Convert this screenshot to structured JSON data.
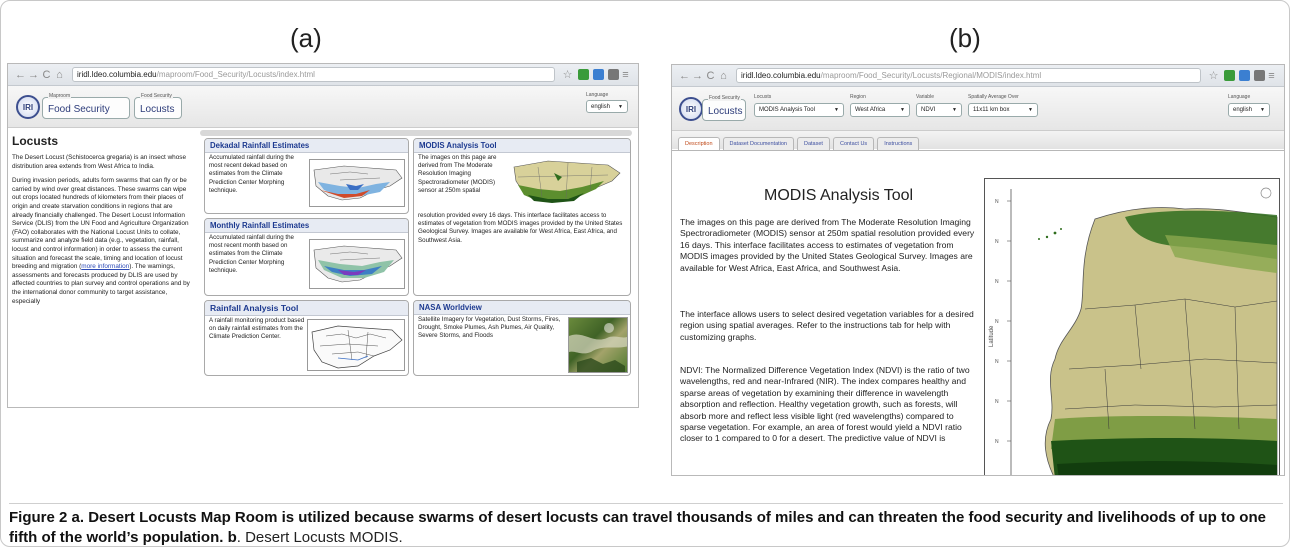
{
  "panel_a": {
    "letter": "(a)",
    "browser": {
      "back": "←",
      "forward": "→",
      "reload": "C",
      "home": "⌂",
      "url_host": "iridl.ldeo.columbia.edu",
      "url_path": "/maproom/Food_Security/Locusts/index.html",
      "menu": "≡"
    },
    "header": {
      "logo": "IRI",
      "crumb1_caption": "Maproom",
      "crumb1_value": "Food Security",
      "crumb2_caption": "Food Security",
      "crumb2_value": "Locusts",
      "language_caption": "Language",
      "language_value": "english"
    },
    "intro": {
      "title": "Locusts",
      "para1": "The Desert Locust (Schistocerca gregaria) is an insect whose distribution area extends from West Africa to India.",
      "para2_start": "During invasion periods, adults form swarms that can fly or be carried by wind over great distances. These swarms can wipe out crops located hundreds of kilometers from their places of origin and create starvation conditions in regions that are already financially challenged. The Desert Locust Information Service (DLIS) from the UN Food and Agriculture Organization (FAO) collaborates with the National Locust Units to collate, summarize and analyze field data (e.g., vegetation, rainfall, locust and control information) in order to assess the current situation and forecast the scale, timing and location of locust breeding and migration (",
      "para2_link": "more information",
      "para2_end": "). The warnings, assessments and forecasts produced by DLIS are used by affected countries to plan survey and control operations and by the international donor community to target assistance, especially"
    },
    "cards": {
      "dekadal_title": "Dekadal Rainfall Estimates",
      "dekadal_text": "Accumulated rainfall during the most recent dekad based on estimates from the Climate Prediction Center Morphing technique.",
      "monthly_title": "Monthly Rainfall Estimates",
      "monthly_text": "Accumulated rainfall during the most recent month based on estimates from the Climate Prediction Center Morphing technique.",
      "rainfall_title": "Rainfall Analysis Tool",
      "rainfall_text": "A rainfall monitoring product based on daily rainfall estimates from the Climate Prediction Center.",
      "modis_title": "MODIS Analysis Tool",
      "modis_text_top": "The images on this page are derived from The Moderate Resolution Imaging Spectroradiometer (MODIS) sensor at 250m spatial",
      "modis_text_bottom": "resolution provided every 16 days. This interface facilitates access to estimates of vegetation from MODIS images provided by the United States Geological Survey. Images are available for West Africa, East Africa, and Southwest Asia.",
      "nasa_title": "NASA Worldview",
      "nasa_text": "Satellite Imagery for Vegetation, Dust Storms, Fires, Drought, Smoke Plumes, Ash Plumes, Air Quality, Severe Storms, and Floods"
    }
  },
  "panel_b": {
    "letter": "(b)",
    "browser": {
      "url_host": "iridl.ldeo.columbia.edu",
      "url_path": "/maproom/Food_Security/Locusts/Regional/MODIS/index.html"
    },
    "header": {
      "logo": "IRI",
      "crumb_caption": "Food Security",
      "crumb_value": "Locusts",
      "locusts_caption": "Locusts",
      "locusts_value": "MODIS Analysis Tool",
      "region_caption": "Region",
      "region_value": "West Africa",
      "variable_caption": "Variable",
      "variable_value": "NDVI",
      "spatial_caption": "Spatially Average Over",
      "spatial_value": "11x11 km box",
      "language_caption": "Language",
      "language_value": "english"
    },
    "tabs": [
      "Description",
      "Dataset Documentation",
      "Dataset",
      "Contact Us",
      "Instructions"
    ],
    "title": "MODIS Analysis Tool",
    "para1": "The images on this page are derived from The Moderate Resolution Imaging Spectroradiometer (MODIS) sensor at 250m spatial resolution provided every 16 days. This interface facilitates access to estimates of vegetation from MODIS images provided by the United States Geological Survey. Images are available for West Africa, East Africa, and Southwest Asia.",
    "para2": "The interface allows users to select desired vegetation variables for a desired region using spatial averages. Refer to the instructions tab for help with customizing graphs.",
    "para3": "NDVI: The Normalized Difference Vegetation Index (NDVI) is the ratio of two wavelengths, red and near-Infrared (NIR). The index compares healthy and sparse areas of vegetation by examining their difference in wavelength absorption and reflection. Healthy vegetation growth, such as forests, will absorb more and reflect less visible light (red wavelengths) compared to sparse vegetation. For example, an area of forest would yield a NDVI ratio closer to 1 compared to 0 for a desert. The predictive value of NDVI is",
    "map_axis_label": "Latitude",
    "map_ticks": [
      "N",
      "N",
      "N",
      "N",
      "N",
      "N",
      "N"
    ]
  },
  "caption": {
    "lead": "Figure 2",
    "part_a_bold": "a. Desert Locusts Map Room is utilized because swarms of desert locusts can travel thousands of miles and can threaten the food security and livelihoods of up to one fifth of the world’s population.",
    "part_b_bold": "b",
    "part_b_text": ". Desert Locusts MODIS."
  },
  "colors": {
    "link": "#1d3a90",
    "accent_tab": "#c04a1a",
    "vegetation": "#2f6d1d",
    "desert": "#c9c28a"
  }
}
